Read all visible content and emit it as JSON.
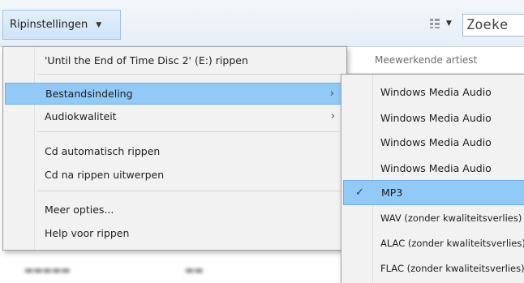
{
  "toolbar": {
    "rip_settings_label": "Ripinstellingen",
    "search_placeholder": "Zoeke",
    "icons": [
      "chevron-down-icon",
      "view-options-icon"
    ]
  },
  "list": {
    "column_header": "Meewerkende artiest"
  },
  "menu": {
    "items": [
      {
        "label": "'Until the End of Time Disc 2' (E:) rippen"
      },
      {
        "label": "Bestandsindeling",
        "has_submenu": true,
        "active": true
      },
      {
        "label": "Audiokwaliteit",
        "has_submenu": true
      },
      {
        "label": "Cd automatisch rippen"
      },
      {
        "label": "Cd na rippen uitwerpen"
      },
      {
        "label": "Meer opties..."
      },
      {
        "label": "Help voor rippen"
      }
    ],
    "submenu_arrow": "›"
  },
  "submenu": {
    "items": [
      {
        "label": "Windows Media Audio"
      },
      {
        "label": "Windows Media Audio"
      },
      {
        "label": "Windows Media Audio"
      },
      {
        "label": "Windows Media Audio"
      },
      {
        "label": "MP3",
        "checked": true
      },
      {
        "label": "WAV (zonder kwaliteitsverlies)"
      },
      {
        "label": "ALAC (zonder kwaliteitsverlies)"
      },
      {
        "label": "FLAC (zonder kwaliteitsverlies)"
      }
    ],
    "check_mark": "✓"
  },
  "colors": {
    "highlight": "#91c9f7",
    "highlight_border": "#6fb0e8",
    "menu_bg": "#f2f2f2",
    "toolbar_button_bg": "#cfe3f6"
  }
}
